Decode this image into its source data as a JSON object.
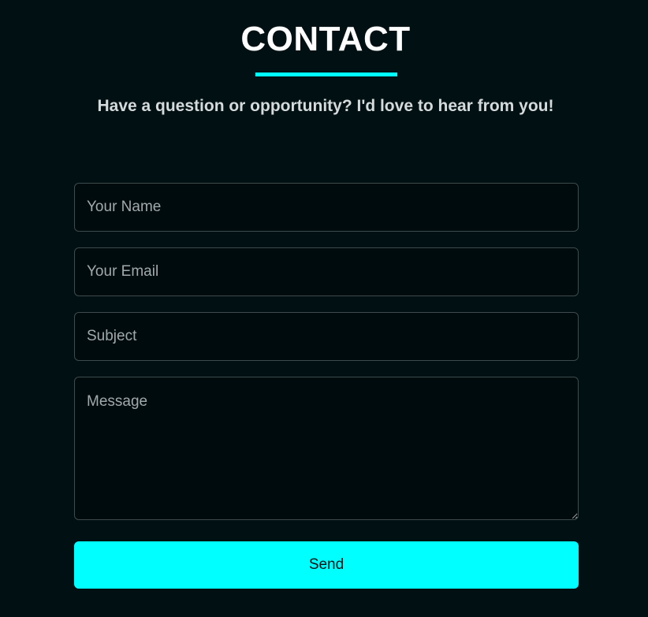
{
  "header": {
    "title": "CONTACT",
    "subtitle": "Have a question or opportunity? I'd love to hear from you!"
  },
  "form": {
    "name": {
      "placeholder": "Your Name",
      "value": ""
    },
    "email": {
      "placeholder": "Your Email",
      "value": ""
    },
    "subject": {
      "placeholder": "Subject",
      "value": ""
    },
    "message": {
      "placeholder": "Message",
      "value": ""
    },
    "send_label": "Send"
  },
  "colors": {
    "background": "#011012",
    "accent": "#00ffff",
    "title_text": "#ffffff",
    "subtitle_text": "#d5dadc",
    "field_border": "#3d4a4e",
    "placeholder_text": "#a2a9ad",
    "button_text": "#041315"
  }
}
